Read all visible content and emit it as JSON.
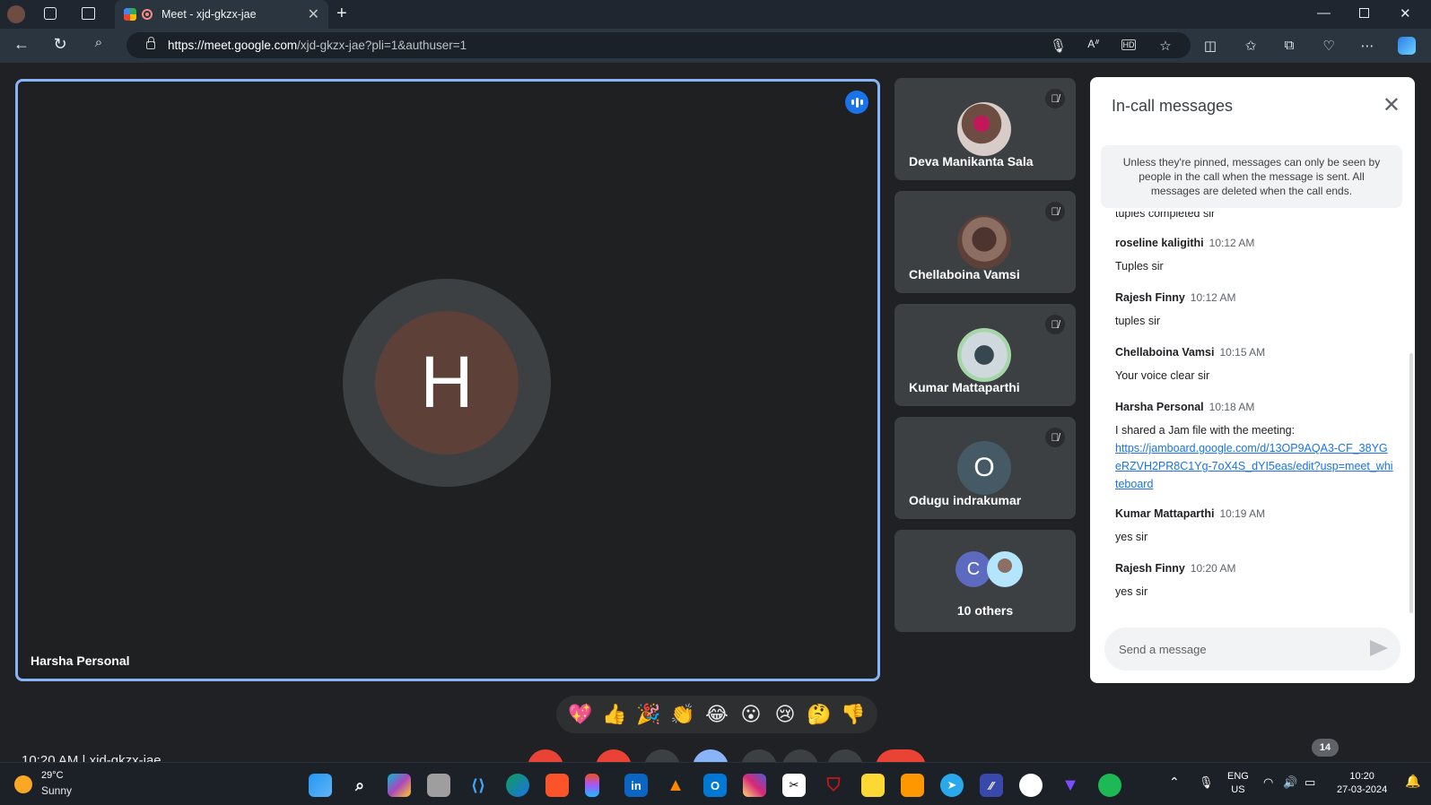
{
  "browser": {
    "tab_title": "Meet - xjd-gkzx-jae",
    "url_host": "https://meet.google.com",
    "url_path": "/xjd-gkzx-jae?pli=1&authuser=1"
  },
  "main_tile": {
    "initial": "H",
    "name": "Harsha Personal"
  },
  "participants": [
    {
      "name": "Deva Manikanta Sala",
      "muted": true
    },
    {
      "name": "Chellaboina Vamsi",
      "muted": true
    },
    {
      "name": "Kumar Mattaparthi",
      "muted": true
    },
    {
      "name": "Odugu indrakumar",
      "initial": "O",
      "muted": true
    }
  ],
  "others": {
    "initial": "C",
    "label": "10 others"
  },
  "chat": {
    "title": "In-call messages",
    "notice": "Unless they're pinned, messages can only be seen by people in the call when the message is sent. All messages are deleted when the call ends.",
    "partial_text": "tuples completed sir",
    "messages": [
      {
        "sender": "roseline kaligithi",
        "time": "10:12 AM",
        "text": "Tuples sir"
      },
      {
        "sender": "Rajesh Finny",
        "time": "10:12 AM",
        "text": "tuples sir"
      },
      {
        "sender": "Chellaboina Vamsi",
        "time": "10:15 AM",
        "text": "Your voice clear sir"
      },
      {
        "sender": "Harsha Personal",
        "time": "10:18 AM",
        "text": "I shared a Jam file with the meeting:",
        "link": "https://jamboard.google.com/d/13OP9AQA3-CF_38YGeRZVH2PR8C1Yg-7oX4S_dYI5eas/edit?usp=meet_whiteboard"
      },
      {
        "sender": "Kumar Mattaparthi",
        "time": "10:19 AM",
        "text": "yes sir"
      },
      {
        "sender": "Rajesh Finny",
        "time": "10:20 AM",
        "text": "yes sir"
      }
    ],
    "input_placeholder": "Send a message"
  },
  "reactions": [
    "💖",
    "👍",
    "🎉",
    "👏",
    "😂",
    "😮",
    "😢",
    "🤔",
    "👎"
  ],
  "bottom": {
    "meeting_info": "10:20 AM | xjd-gkzx-jae",
    "people_count": "14"
  },
  "taskbar": {
    "weather_temp": "29°C",
    "weather_condition": "Sunny",
    "lang_top": "ENG",
    "lang_bottom": "US",
    "clock_time": "10:20",
    "clock_date": "27-03-2024"
  },
  "colors": {
    "accent": "#8ab4f8",
    "avatar_h": "#5d4037",
    "hangup": "#ea4335",
    "link": "#1a73e8"
  }
}
